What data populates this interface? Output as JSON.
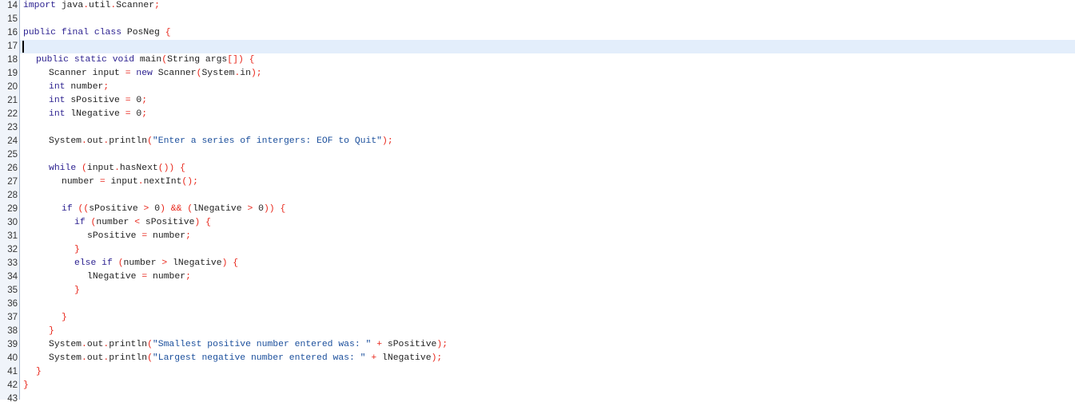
{
  "editor": {
    "current_line": 17,
    "colors": {
      "keyword": "#2a1f8f",
      "punctuation": "#e8261a",
      "string": "#1b4f9c",
      "identifier": "#222222",
      "current_line_bg": "#e3eefb",
      "gutter_bg": "#f0f4fa"
    },
    "lines": [
      {
        "n": "14",
        "indent": 0,
        "tokens": [
          [
            "k",
            "import"
          ],
          [
            "i",
            " java"
          ],
          [
            "p",
            "."
          ],
          [
            "i",
            "util"
          ],
          [
            "p",
            "."
          ],
          [
            "i",
            "Scanner"
          ],
          [
            "p",
            ";"
          ]
        ]
      },
      {
        "n": "15",
        "indent": 0,
        "tokens": []
      },
      {
        "n": "16",
        "indent": 0,
        "tokens": [
          [
            "k",
            "public final class"
          ],
          [
            "i",
            " PosNeg "
          ],
          [
            "p",
            "{"
          ]
        ]
      },
      {
        "n": "17",
        "indent": 0,
        "tokens": []
      },
      {
        "n": "18",
        "indent": 1,
        "tokens": [
          [
            "k",
            "public static void"
          ],
          [
            "i",
            " main"
          ],
          [
            "p",
            "("
          ],
          [
            "i",
            "String args"
          ],
          [
            "p",
            "[]) {"
          ]
        ]
      },
      {
        "n": "19",
        "indent": 2,
        "tokens": [
          [
            "i",
            "Scanner input "
          ],
          [
            "p",
            "="
          ],
          [
            "i",
            " "
          ],
          [
            "k",
            "new"
          ],
          [
            "i",
            " Scanner"
          ],
          [
            "p",
            "("
          ],
          [
            "i",
            "System"
          ],
          [
            "p",
            "."
          ],
          [
            "i",
            "in"
          ],
          [
            "p",
            ");"
          ]
        ]
      },
      {
        "n": "20",
        "indent": 2,
        "tokens": [
          [
            "k",
            "int"
          ],
          [
            "i",
            " number"
          ],
          [
            "p",
            ";"
          ]
        ]
      },
      {
        "n": "21",
        "indent": 2,
        "tokens": [
          [
            "k",
            "int"
          ],
          [
            "i",
            " sPositive "
          ],
          [
            "p",
            "="
          ],
          [
            "i",
            " 0"
          ],
          [
            "p",
            ";"
          ]
        ]
      },
      {
        "n": "22",
        "indent": 2,
        "tokens": [
          [
            "k",
            "int"
          ],
          [
            "i",
            " lNegative "
          ],
          [
            "p",
            "="
          ],
          [
            "i",
            " 0"
          ],
          [
            "p",
            ";"
          ]
        ]
      },
      {
        "n": "23",
        "indent": 0,
        "tokens": []
      },
      {
        "n": "24",
        "indent": 2,
        "tokens": [
          [
            "i",
            "System"
          ],
          [
            "p",
            "."
          ],
          [
            "i",
            "out"
          ],
          [
            "p",
            "."
          ],
          [
            "i",
            "println"
          ],
          [
            "p",
            "("
          ],
          [
            "s",
            "\"Enter a series of intergers: EOF to Quit\""
          ],
          [
            "p",
            ");"
          ]
        ]
      },
      {
        "n": "25",
        "indent": 0,
        "tokens": []
      },
      {
        "n": "26",
        "indent": 2,
        "tokens": [
          [
            "k",
            "while"
          ],
          [
            "i",
            " "
          ],
          [
            "p",
            "("
          ],
          [
            "i",
            "input"
          ],
          [
            "p",
            "."
          ],
          [
            "i",
            "hasNext"
          ],
          [
            "p",
            "()) {"
          ]
        ]
      },
      {
        "n": "27",
        "indent": 3,
        "tokens": [
          [
            "i",
            "number "
          ],
          [
            "p",
            "="
          ],
          [
            "i",
            " input"
          ],
          [
            "p",
            "."
          ],
          [
            "i",
            "nextInt"
          ],
          [
            "p",
            "();"
          ]
        ]
      },
      {
        "n": "28",
        "indent": 0,
        "tokens": []
      },
      {
        "n": "29",
        "indent": 3,
        "tokens": [
          [
            "k",
            "if"
          ],
          [
            "i",
            " "
          ],
          [
            "p",
            "(("
          ],
          [
            "i",
            "sPositive "
          ],
          [
            "p",
            ">"
          ],
          [
            "i",
            " 0"
          ],
          [
            "p",
            ") && ("
          ],
          [
            "i",
            "lNegative "
          ],
          [
            "p",
            ">"
          ],
          [
            "i",
            " 0"
          ],
          [
            "p",
            ")) {"
          ]
        ]
      },
      {
        "n": "30",
        "indent": 4,
        "tokens": [
          [
            "k",
            "if"
          ],
          [
            "i",
            " "
          ],
          [
            "p",
            "("
          ],
          [
            "i",
            "number "
          ],
          [
            "p",
            "<"
          ],
          [
            "i",
            " sPositive"
          ],
          [
            "p",
            ") {"
          ]
        ]
      },
      {
        "n": "31",
        "indent": 5,
        "tokens": [
          [
            "i",
            "sPositive "
          ],
          [
            "p",
            "="
          ],
          [
            "i",
            " number"
          ],
          [
            "p",
            ";"
          ]
        ]
      },
      {
        "n": "32",
        "indent": 4,
        "tokens": [
          [
            "p",
            "}"
          ]
        ]
      },
      {
        "n": "33",
        "indent": 4,
        "tokens": [
          [
            "k",
            "else if"
          ],
          [
            "i",
            " "
          ],
          [
            "p",
            "("
          ],
          [
            "i",
            "number "
          ],
          [
            "p",
            ">"
          ],
          [
            "i",
            " lNegative"
          ],
          [
            "p",
            ") {"
          ]
        ]
      },
      {
        "n": "34",
        "indent": 5,
        "tokens": [
          [
            "i",
            "lNegative "
          ],
          [
            "p",
            "="
          ],
          [
            "i",
            " number"
          ],
          [
            "p",
            ";"
          ]
        ]
      },
      {
        "n": "35",
        "indent": 4,
        "tokens": [
          [
            "p",
            "}"
          ]
        ]
      },
      {
        "n": "36",
        "indent": 0,
        "tokens": []
      },
      {
        "n": "37",
        "indent": 3,
        "tokens": [
          [
            "p",
            "}"
          ]
        ]
      },
      {
        "n": "38",
        "indent": 2,
        "tokens": [
          [
            "p",
            "}"
          ]
        ]
      },
      {
        "n": "39",
        "indent": 2,
        "tokens": [
          [
            "i",
            "System"
          ],
          [
            "p",
            "."
          ],
          [
            "i",
            "out"
          ],
          [
            "p",
            "."
          ],
          [
            "i",
            "println"
          ],
          [
            "p",
            "("
          ],
          [
            "s",
            "\"Smallest positive number entered was: \""
          ],
          [
            "i",
            " "
          ],
          [
            "p",
            "+"
          ],
          [
            "i",
            " sPositive"
          ],
          [
            "p",
            ");"
          ]
        ]
      },
      {
        "n": "40",
        "indent": 2,
        "tokens": [
          [
            "i",
            "System"
          ],
          [
            "p",
            "."
          ],
          [
            "i",
            "out"
          ],
          [
            "p",
            "."
          ],
          [
            "i",
            "println"
          ],
          [
            "p",
            "("
          ],
          [
            "s",
            "\"Largest negative number entered was: \""
          ],
          [
            "i",
            " "
          ],
          [
            "p",
            "+"
          ],
          [
            "i",
            " lNegative"
          ],
          [
            "p",
            ");"
          ]
        ]
      },
      {
        "n": "41",
        "indent": 1,
        "tokens": [
          [
            "p",
            "}"
          ]
        ]
      },
      {
        "n": "42",
        "indent": 0,
        "tokens": [
          [
            "p",
            "}"
          ]
        ]
      },
      {
        "n": "43",
        "indent": 0,
        "tokens": []
      }
    ]
  }
}
